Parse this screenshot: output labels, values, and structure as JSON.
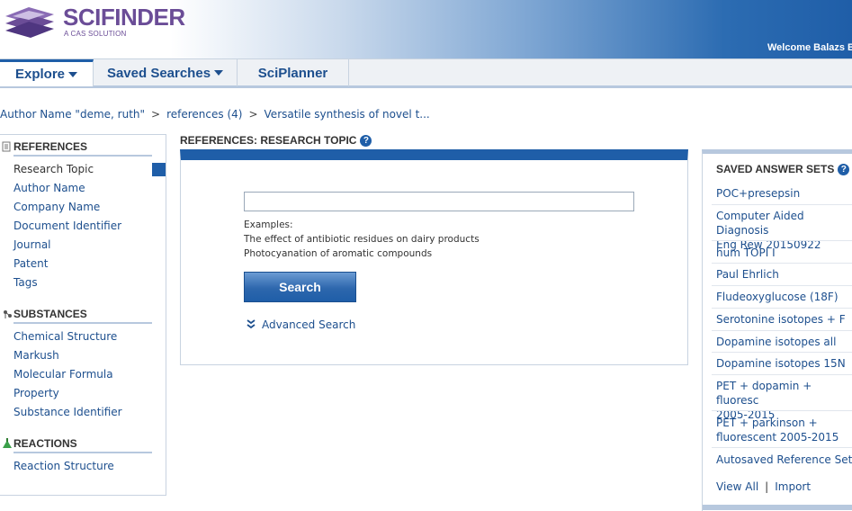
{
  "header": {
    "logo_word": "SCIFINDER",
    "logo_tagline": "A CAS SOLUTION",
    "welcome": "Welcome Balazs Ba"
  },
  "nav": {
    "tabs": [
      {
        "label": "Explore",
        "dropdown": true,
        "active": true
      },
      {
        "label": "Saved Searches",
        "dropdown": true,
        "active": false
      },
      {
        "label": "SciPlanner",
        "dropdown": false,
        "active": false
      }
    ]
  },
  "breadcrumb": {
    "items": [
      "Author Name \"deme, ruth\"",
      "references (4)",
      "Versatile synthesis of novel t..."
    ],
    "separator": ">"
  },
  "sidebar": {
    "sections": [
      {
        "title": "REFERENCES",
        "icon": "references-icon",
        "items": [
          "Research Topic",
          "Author Name",
          "Company Name",
          "Document Identifier",
          "Journal",
          "Patent",
          "Tags"
        ]
      },
      {
        "title": "SUBSTANCES",
        "icon": "substances-icon",
        "items": [
          "Chemical Structure",
          "Markush",
          "Molecular Formula",
          "Property",
          "Substance Identifier"
        ]
      },
      {
        "title": "REACTIONS",
        "icon": "reactions-icon",
        "items": [
          "Reaction Structure"
        ]
      }
    ],
    "selected": "Research Topic"
  },
  "main": {
    "title": "REFERENCES: RESEARCH TOPIC",
    "help": "?",
    "input_value": "",
    "examples_label": "Examples:",
    "examples": [
      "The effect of antibiotic residues on dairy products",
      "Photocyanation of aromatic compounds"
    ],
    "search_label": "Search",
    "advanced_label": "Advanced Search"
  },
  "saved_answer_sets": {
    "title": "SAVED ANSWER SETS",
    "help": "?",
    "items": [
      "POC+presepsin",
      "Computer Aided Diagnosis\nEng Rew 20150922",
      "hum TOPI I",
      "Paul Ehrlich",
      "Fludeoxyglucose (18F)",
      "Serotonine isotopes + F",
      "Dopamine isotopes all",
      "Dopamine isotopes 15N",
      "PET + dopamin + fluoresc\n2005-2015",
      "PET + parkinson +\nfluorescent 2005-2015",
      "Autosaved Reference Set"
    ],
    "view_all": "View All",
    "divider": "|",
    "import": "Import"
  },
  "colors": {
    "brand_purple": "#6b4d97",
    "accent_blue": "#1f5ea8",
    "link_blue": "#1d4f8e"
  }
}
